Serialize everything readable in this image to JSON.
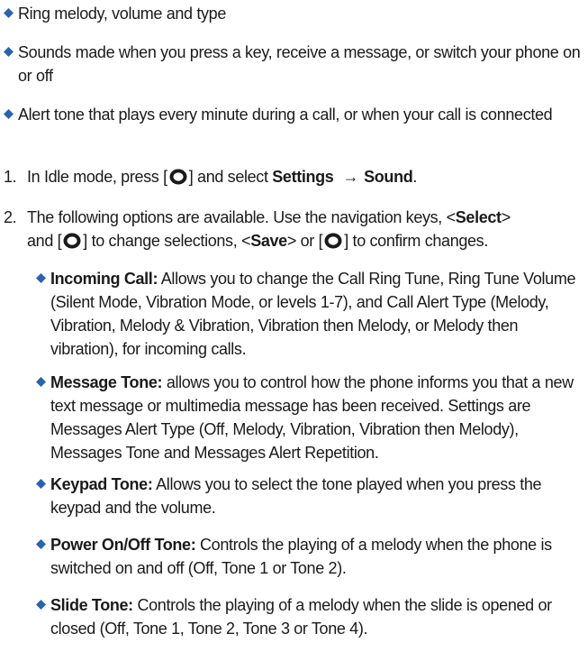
{
  "intro_bullets": [
    "Ring melody, volume and type",
    "Sounds made when you press a key, receive a message, or switch your phone on or off",
    "Alert tone that plays every minute during a call, or when your call is connected"
  ],
  "step1": {
    "number": "1.",
    "text_before": "In Idle mode, press [",
    "text_mid": "] and select",
    "settings": "Settings",
    "arrow": "→",
    "sound": "Sound",
    "end": "."
  },
  "step2": {
    "number": "2.",
    "line1": "The following options are available. Use the navigation keys, <",
    "select": "Select",
    "line1_end": ">",
    "line2a": "and [",
    "line2b": "] to change selections, <",
    "save": "Save",
    "line2c": "> or [",
    "line2d": "] to confirm changes."
  },
  "options": [
    {
      "title": "Incoming Call:",
      "text": "Allows you to change the Call Ring Tune, Ring Tune Volume (Silent Mode, Vibration Mode, or levels 1-7), and Call Alert Type (Melody, Vibration, Melody & Vibration, Vibration then Melody, or Melody then vibration), for incoming calls."
    },
    {
      "title": "Message Tone:",
      "text": "allows you to control how the phone informs you that a new text message or multimedia message has been received. Settings are Messages Alert Type (Off, Melody, Vibration, Vibration then Melody), Messages Tone and Messages Alert Repetition."
    },
    {
      "title": "Keypad Tone:",
      "text": "Allows you to select the tone played when you press the keypad and the volume."
    },
    {
      "title": "Power On/Off Tone:",
      "text": "Controls the playing of a melody when the phone is switched on and off (Off, Tone 1 or Tone 2)."
    },
    {
      "title": "Slide Tone:",
      "text": "Controls the playing of a melody when the slide is opened or closed (Off, Tone 1, Tone 2, Tone 3 or Tone 4)."
    }
  ],
  "colors": {
    "bullet": "#2a62ad",
    "text": "#1a1a1a"
  },
  "icons": {
    "bullet": "diamond-bullet-icon",
    "key": "ok-key-icon"
  }
}
